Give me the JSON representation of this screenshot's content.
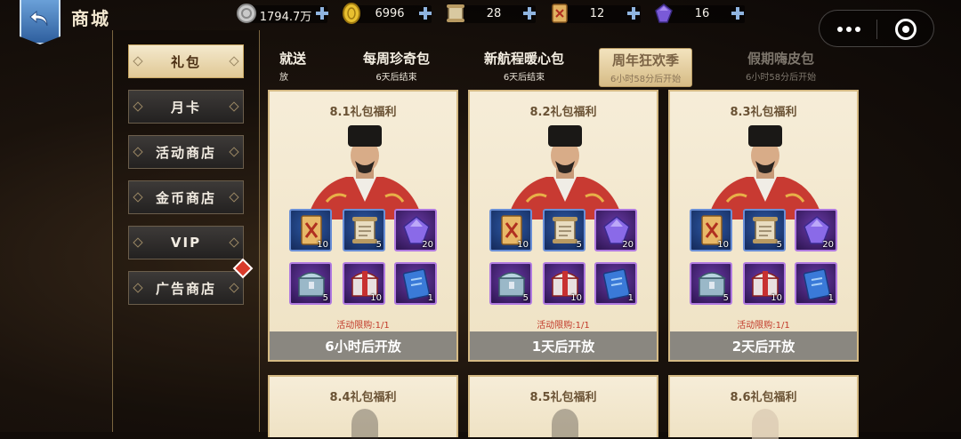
{
  "header": {
    "title": "商城",
    "resources": [
      {
        "icon": "silver-coin-icon",
        "value": "1794.7万"
      },
      {
        "icon": "gold-coin-icon",
        "value": "6996"
      },
      {
        "icon": "scroll-icon",
        "value": "28"
      },
      {
        "icon": "token-card-icon",
        "value": "12"
      },
      {
        "icon": "purple-gem-icon",
        "value": "16"
      }
    ]
  },
  "sidebar": {
    "items": [
      {
        "label": "礼包",
        "active": true
      },
      {
        "label": "月卡"
      },
      {
        "label": "活动商店"
      },
      {
        "label": "金币商店"
      },
      {
        "label": "VIP"
      },
      {
        "label": "广告商店",
        "badge": true
      }
    ]
  },
  "tabs": [
    {
      "label": "就送",
      "sub": "放"
    },
    {
      "label": "每周珍奇包",
      "sub": "6天后结束"
    },
    {
      "label": "新航程暖心包",
      "sub": "6天后结束"
    },
    {
      "label": "周年狂欢季",
      "sub": "6小时58分后开始",
      "active": true
    },
    {
      "label": "假期嗨皮包",
      "sub": "6小时58分后开始",
      "dim": true
    }
  ],
  "cards": [
    {
      "title": "8.1礼包福利",
      "limit": "活动限购:1/1",
      "status": "6小时后开放",
      "items": [
        {
          "icon": "token-card-icon",
          "qty": "10"
        },
        {
          "icon": "scroll-icon",
          "qty": "5"
        },
        {
          "icon": "purple-gem-icon",
          "qty": "20"
        },
        {
          "icon": "silver-chest-icon",
          "qty": "5"
        },
        {
          "icon": "gift-chest-icon",
          "qty": "10"
        },
        {
          "icon": "blue-ticket-icon",
          "qty": "1"
        }
      ]
    },
    {
      "title": "8.2礼包福利",
      "limit": "活动限购:1/1",
      "status": "1天后开放",
      "items": [
        {
          "icon": "token-card-icon",
          "qty": "10"
        },
        {
          "icon": "scroll-icon",
          "qty": "5"
        },
        {
          "icon": "purple-gem-icon",
          "qty": "20"
        },
        {
          "icon": "silver-chest-icon",
          "qty": "5"
        },
        {
          "icon": "gift-chest-icon",
          "qty": "10"
        },
        {
          "icon": "blue-ticket-icon",
          "qty": "1"
        }
      ]
    },
    {
      "title": "8.3礼包福利",
      "limit": "活动限购:1/1",
      "status": "2天后开放",
      "items": [
        {
          "icon": "token-card-icon",
          "qty": "10"
        },
        {
          "icon": "scroll-icon",
          "qty": "5"
        },
        {
          "icon": "purple-gem-icon",
          "qty": "20"
        },
        {
          "icon": "silver-chest-icon",
          "qty": "5"
        },
        {
          "icon": "gift-chest-icon",
          "qty": "10"
        },
        {
          "icon": "blue-ticket-icon",
          "qty": "1"
        }
      ]
    }
  ],
  "cards_lower": [
    {
      "title": "8.4礼包福利"
    },
    {
      "title": "8.5礼包福利"
    },
    {
      "title": "8.6礼包福利"
    }
  ]
}
